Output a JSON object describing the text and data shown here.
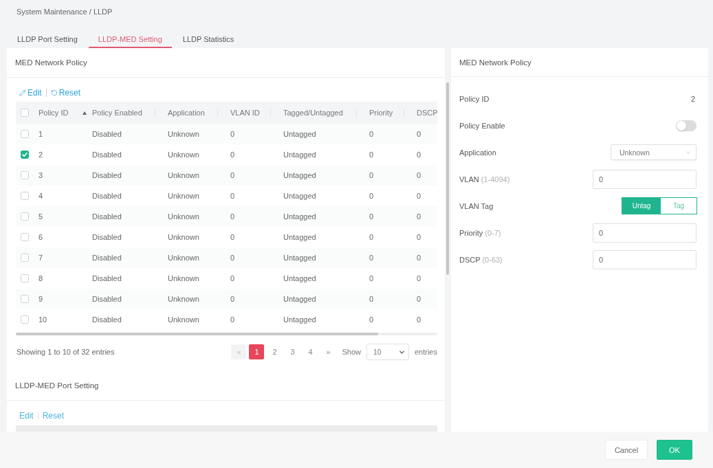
{
  "breadcrumb": "System Maintenance / LLDP",
  "tabs": [
    {
      "label": "LLDP Port Setting",
      "selected": false
    },
    {
      "label": "LLDP-MED Setting",
      "selected": true
    },
    {
      "label": "LLDP Statistics",
      "selected": false
    }
  ],
  "policy_panel": {
    "title": "MED Network Policy",
    "actions": [
      {
        "kind": "icon_link",
        "label": "Edit"
      },
      {
        "kind": "icon_link",
        "label": "Reset"
      }
    ],
    "table": {
      "select_all": {
        "checked": false
      },
      "columns": [
        {
          "label": "Policy ID",
          "sorted": true
        },
        {
          "label": "Policy Enabled",
          "sorted": false
        },
        {
          "label": "Application",
          "sorted": false
        },
        {
          "label": "VLAN ID",
          "sorted": false
        },
        {
          "label": "Tagged/Untagged",
          "sorted": false
        },
        {
          "label": "Priority",
          "sorted": false
        },
        {
          "label": "DSCP",
          "sorted": false
        }
      ],
      "rows": [
        {
          "checked": false,
          "cells": [
            "1",
            "Disabled",
            "Unknown",
            "0",
            "Untagged",
            "0",
            "0"
          ]
        },
        {
          "checked": true,
          "cells": [
            "2",
            "Disabled",
            "Unknown",
            "0",
            "Untagged",
            "0",
            "0"
          ]
        },
        {
          "checked": false,
          "cells": [
            "3",
            "Disabled",
            "Unknown",
            "0",
            "Untagged",
            "0",
            "0"
          ]
        },
        {
          "checked": false,
          "cells": [
            "4",
            "Disabled",
            "Unknown",
            "0",
            "Untagged",
            "0",
            "0"
          ]
        },
        {
          "checked": false,
          "cells": [
            "5",
            "Disabled",
            "Unknown",
            "0",
            "Untagged",
            "0",
            "0"
          ]
        },
        {
          "checked": false,
          "cells": [
            "6",
            "Disabled",
            "Unknown",
            "0",
            "Untagged",
            "0",
            "0"
          ]
        },
        {
          "checked": false,
          "cells": [
            "7",
            "Disabled",
            "Unknown",
            "0",
            "Untagged",
            "0",
            "0"
          ]
        },
        {
          "checked": false,
          "cells": [
            "8",
            "Disabled",
            "Unknown",
            "0",
            "Untagged",
            "0",
            "0"
          ]
        },
        {
          "checked": false,
          "cells": [
            "9",
            "Disabled",
            "Unknown",
            "0",
            "Untagged",
            "0",
            "0"
          ]
        },
        {
          "checked": false,
          "cells": [
            "10",
            "Disabled",
            "Unknown",
            "0",
            "Untagged",
            "0",
            "0"
          ]
        }
      ]
    },
    "info": "Showing 1 to 10 of 32 entries",
    "pagination": {
      "prev": {
        "label": "«",
        "disabled": true
      },
      "pages": [
        {
          "label": "1",
          "selected": true
        },
        {
          "label": "2",
          "selected": false
        },
        {
          "label": "3",
          "selected": false
        },
        {
          "label": "4",
          "selected": false
        }
      ],
      "next": {
        "label": "»",
        "disabled": false
      }
    },
    "page_size": {
      "before": "Show",
      "value": "10",
      "after": "entries"
    }
  },
  "port_panel": {
    "title": "LLDP-MED Port Setting",
    "actions": [
      {
        "kind": "text_link",
        "label": "Edit"
      },
      {
        "kind": "text_link",
        "label": "Reset"
      }
    ]
  },
  "detail_panel": {
    "title": "MED Network Policy",
    "fields": [
      {
        "kind": "value",
        "label": "Policy ID",
        "value": "2"
      },
      {
        "kind": "toggle",
        "label": "Policy Enable",
        "on": false
      },
      {
        "kind": "select",
        "label": "Application",
        "value": "Unknown"
      },
      {
        "kind": "input",
        "label": "VLAN",
        "hint": "(1-4094)",
        "value": "0"
      },
      {
        "kind": "segmented",
        "label": "VLAN Tag",
        "options": [
          {
            "label": "Untag",
            "selected": true
          },
          {
            "label": "Tag",
            "selected": false
          }
        ]
      },
      {
        "kind": "input",
        "label": "Priority",
        "hint": "(0-7)",
        "value": "0"
      },
      {
        "kind": "input",
        "label": "DSCP",
        "hint": "(0-63)",
        "value": "0"
      }
    ]
  },
  "footer_buttons": [
    {
      "kind": "secondary",
      "label": "Cancel"
    },
    {
      "kind": "primary",
      "label": "OK"
    }
  ]
}
